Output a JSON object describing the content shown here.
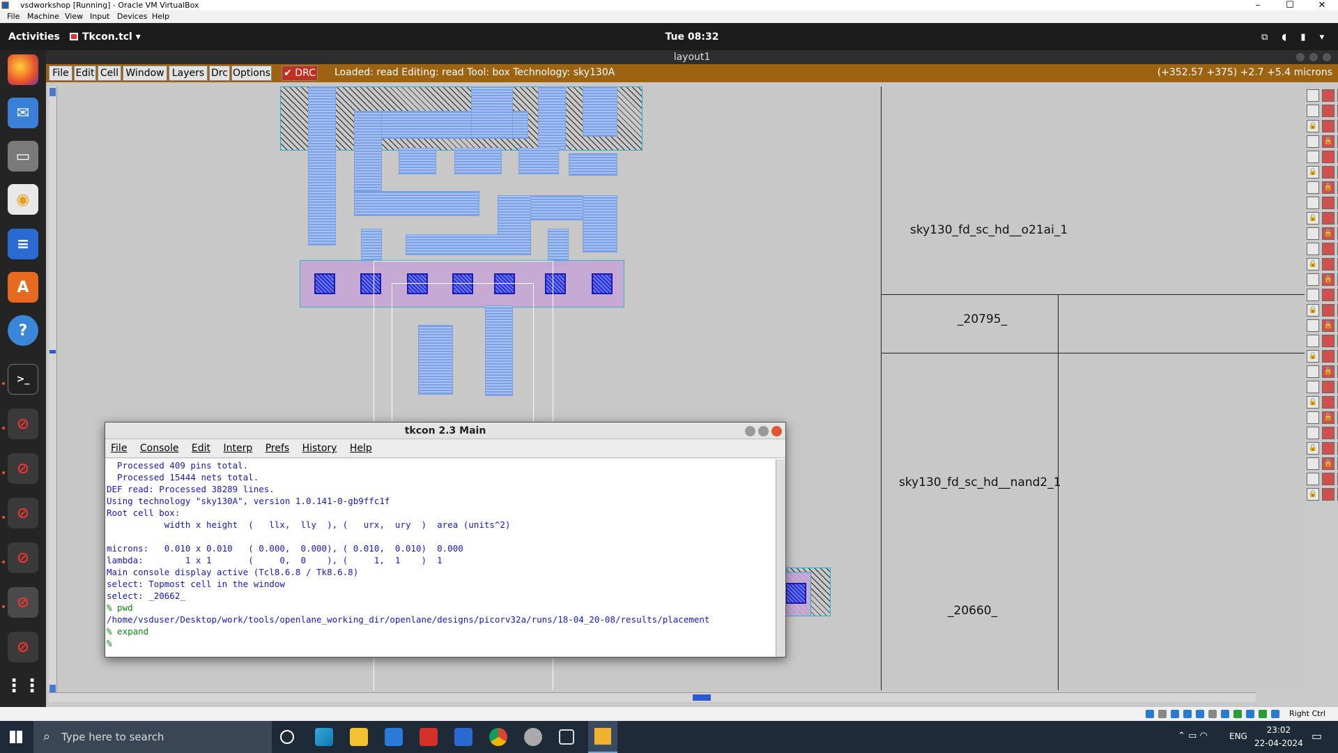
{
  "vbox": {
    "title": "vsdworkshop [Running] - Oracle VM VirtualBox",
    "menu": [
      "File",
      "Machine",
      "View",
      "Input",
      "Devices",
      "Help"
    ],
    "statusbar_right": "Right Ctrl"
  },
  "gnome": {
    "activities": "Activities",
    "app": "Tkcon.tcl ▾",
    "clock": "Tue 08:32"
  },
  "magic": {
    "window_title": "layout1",
    "menu": [
      "File",
      "Edit",
      "Cell",
      "Window",
      "Layers",
      "Drc",
      "Options"
    ],
    "drc_label": "DRC",
    "status": "Loaded: read Editing: read Tool: box  Technology: sky130A",
    "coords": "(+352.57 +375) +2.7 +5.4 microns",
    "cells": [
      {
        "name": "sky130_fd_sc_hd__o21ai_1",
        "inst": "_20795_"
      },
      {
        "name": "sky130_fd_sc_hd__nand2_1",
        "inst": "_20660_"
      }
    ]
  },
  "tkcon": {
    "title": "tkcon 2.3 Main",
    "menu": [
      "File",
      "Console",
      "Edit",
      "Interp",
      "Prefs",
      "History",
      "Help"
    ],
    "lines": [
      "  Processed 409 pins total.",
      "  Processed 15444 nets total.",
      "DEF read: Processed 38289 lines.",
      "Using technology \"sky130A\", version 1.0.141-0-gb9ffc1f",
      "Root cell box:",
      "           width x height  (   llx,  lly  ), (   urx,  ury  )  area (units^2)",
      "",
      "microns:   0.010 x 0.010   ( 0.000,  0.000), ( 0.010,  0.010)  0.000",
      "lambda:        1 x 1       (     0,  0    ), (     1,  1    )  1",
      "Main console display active (Tcl8.6.8 / Tk8.6.8)",
      "select: Topmost cell in the window",
      "select: _20662_"
    ],
    "cmd1": "% pwd",
    "out1": "/home/vsduser/Desktop/work/tools/openlane_working_dir/openlane/designs/picorv32a/runs/18-04_20-08/results/placement",
    "cmd2": "% expand",
    "prompt": "%"
  },
  "taskbar": {
    "search_placeholder": "Type here to search",
    "lang": "ENG",
    "time": "23:02",
    "date": "22-04-2024"
  }
}
